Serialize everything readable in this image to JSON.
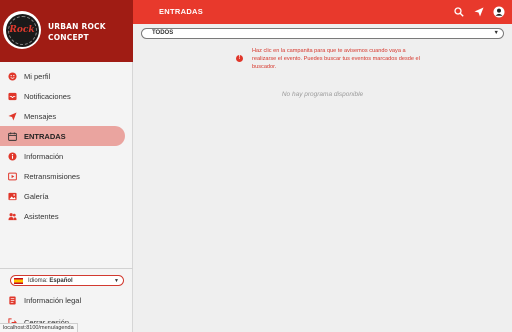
{
  "brand": {
    "name": "URBAN ROCK CONCEPT",
    "logo_text": "Rock"
  },
  "sidebar": {
    "items": [
      {
        "label": "Mi perfil",
        "icon": "smiley-icon"
      },
      {
        "label": "Notificaciones",
        "icon": "inbox-icon"
      },
      {
        "label": "Mensajes",
        "icon": "send-icon"
      },
      {
        "label": "ENTRADAS",
        "icon": "calendar-icon",
        "active": true
      },
      {
        "label": "Información",
        "icon": "info-icon"
      },
      {
        "label": "Retransmisiones",
        "icon": "play-icon"
      },
      {
        "label": "Galería",
        "icon": "image-icon"
      },
      {
        "label": "Asistentes",
        "icon": "people-icon"
      }
    ],
    "language": {
      "label": "Idioma:",
      "value": "Español"
    },
    "legal_label": "Información legal",
    "logout_label": "Cerrar sesión"
  },
  "topbar": {
    "title": "ENTRADAS"
  },
  "filter": {
    "selected": "TODOS"
  },
  "notice": {
    "text": "Haz clic en la campanita para que te avisemos cuando vaya a realizarse el evento. Puedes buscar tus eventos marcados desde el buscador."
  },
  "empty_text": "No hay programa disponible",
  "status_url": "localhost:8100/menu/agenda",
  "colors": {
    "brand_dark": "#a01c14",
    "accent": "#e8392c",
    "active_bg": "#eaa49f"
  }
}
